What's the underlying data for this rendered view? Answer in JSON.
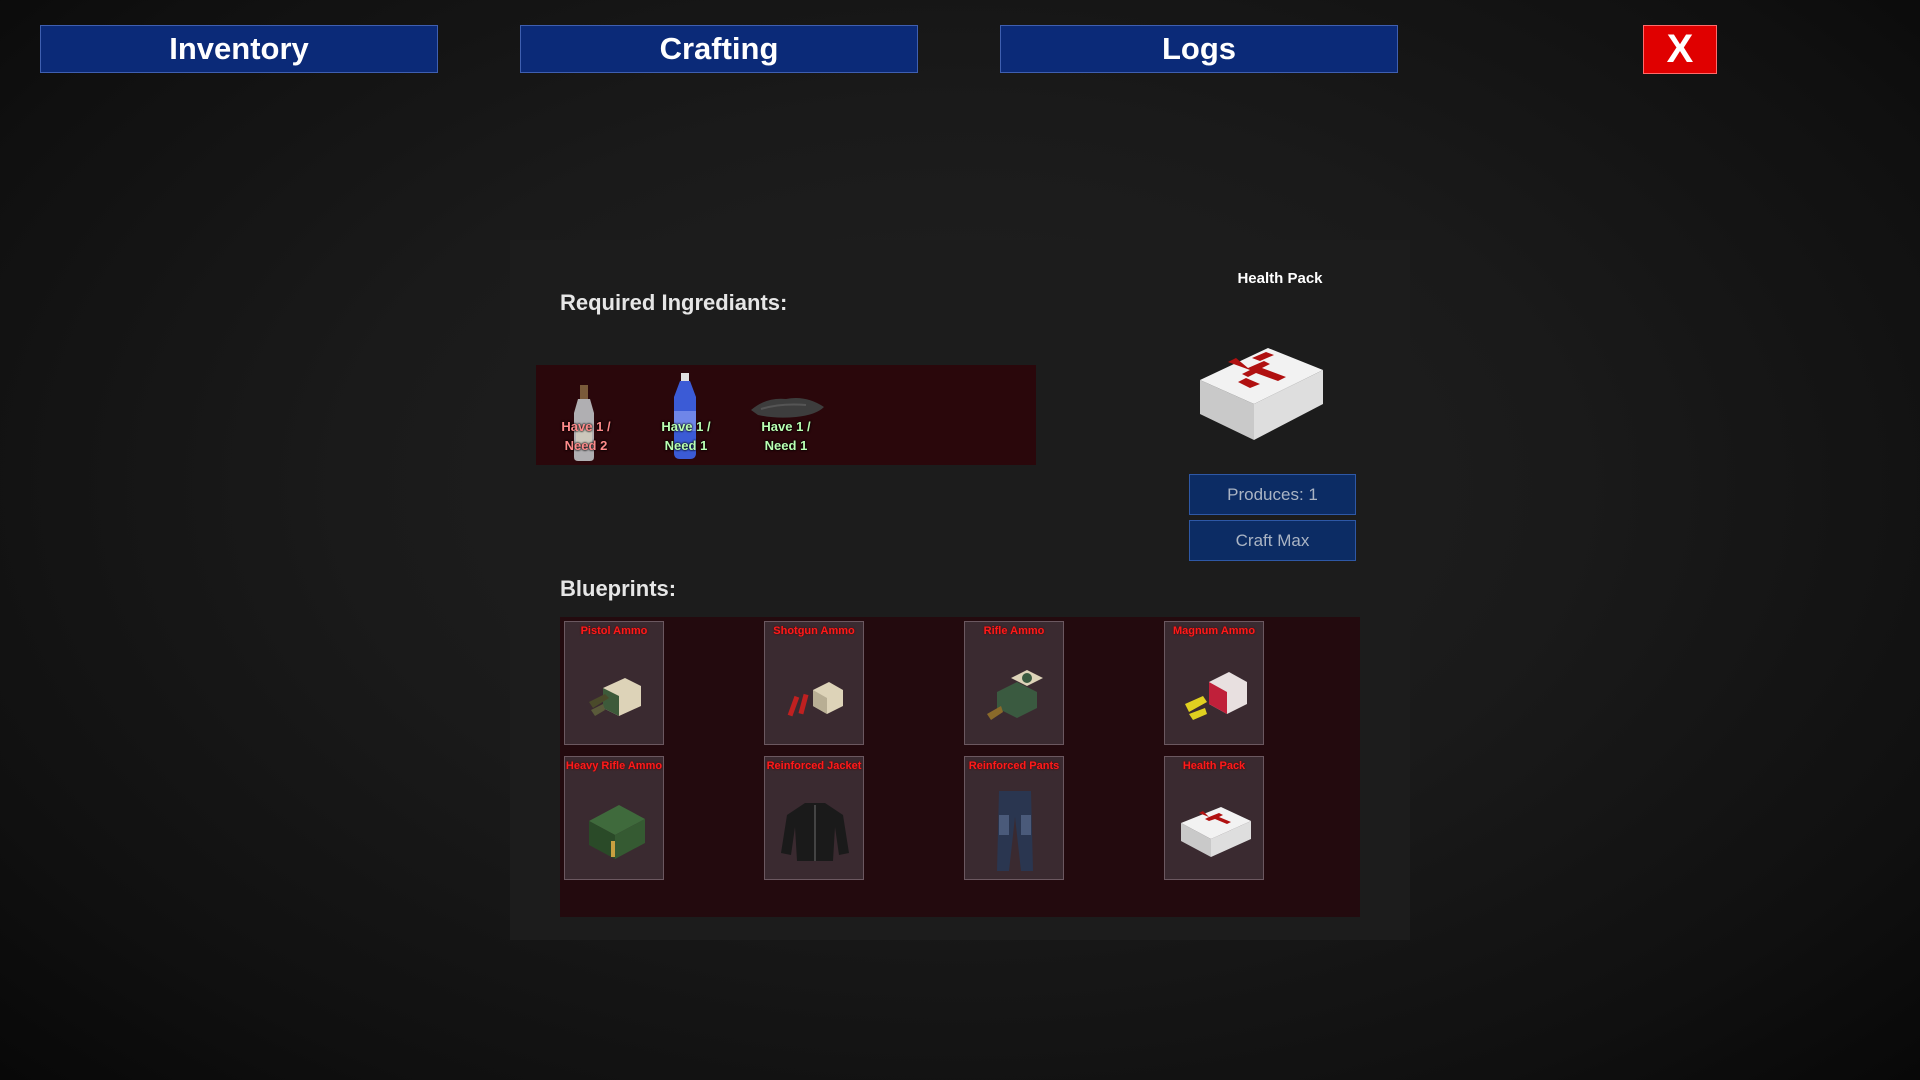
{
  "nav": {
    "tabs": [
      {
        "label": "Inventory"
      },
      {
        "label": "Crafting"
      },
      {
        "label": "Logs"
      }
    ],
    "close_label": "X"
  },
  "crafting": {
    "required_title": "Required Ingrediants:",
    "ingredients": [
      {
        "icon": "glass-bottle-icon",
        "have": 1,
        "need": 2,
        "label_line1": "Have 1 /",
        "label_line2": "Need 2",
        "status": "insufficient"
      },
      {
        "icon": "water-bottle-icon",
        "have": 1,
        "need": 1,
        "label_line1": "Have 1 /",
        "label_line2": "Need 1",
        "status": "sufficient"
      },
      {
        "icon": "cloth-scrap-icon",
        "have": 1,
        "need": 1,
        "label_line1": "Have 1 /",
        "label_line2": "Need 1",
        "status": "sufficient"
      }
    ],
    "product": {
      "name": "Health Pack",
      "icon": "health-pack-icon",
      "produces_label": "Produces: 1",
      "craft_max_label": "Craft Max"
    },
    "blueprints_title": "Blueprints:",
    "blueprints": [
      {
        "label": "Pistol Ammo",
        "icon": "pistol-ammo-icon"
      },
      {
        "label": "Shotgun Ammo",
        "icon": "shotgun-ammo-icon"
      },
      {
        "label": "Rifle Ammo",
        "icon": "rifle-ammo-icon"
      },
      {
        "label": "Magnum Ammo",
        "icon": "magnum-ammo-icon"
      },
      {
        "label": "Heavy Rifle Ammo",
        "icon": "heavy-rifle-ammo-icon"
      },
      {
        "label": "Reinforced Jacket",
        "icon": "jacket-icon"
      },
      {
        "label": "Reinforced Pants",
        "icon": "pants-icon"
      },
      {
        "label": "Health Pack",
        "icon": "health-pack-icon"
      }
    ]
  },
  "colors": {
    "tab_bg": "#0b2a78",
    "close_bg": "#e00000",
    "ingredient_insufficient": "#ff8b8b",
    "ingredient_sufficient": "#b9ffb2",
    "blueprint_label": "#ff1a1a"
  }
}
